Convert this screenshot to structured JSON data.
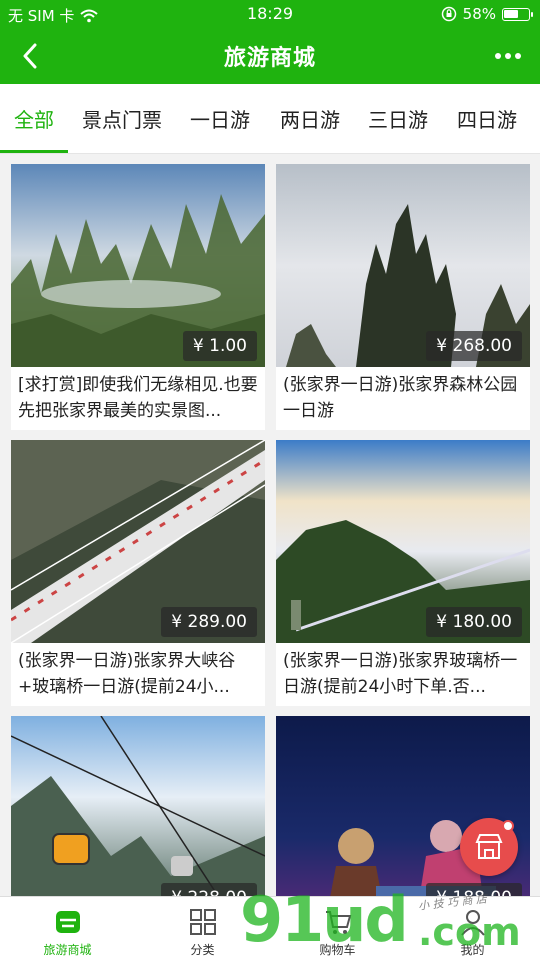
{
  "status": {
    "carrier": "无 SIM 卡",
    "time": "18:29",
    "battery_pct": "58%"
  },
  "navbar": {
    "title": "旅游商城"
  },
  "tabs": [
    {
      "label": "全部"
    },
    {
      "label": "景点门票"
    },
    {
      "label": "一日游"
    },
    {
      "label": "两日游"
    },
    {
      "label": "三日游"
    },
    {
      "label": "四日游"
    }
  ],
  "products": [
    {
      "price": "¥ 1.00",
      "title": "[求打赏]即使我们无缘相见.也要先把张家界最美的实景图..."
    },
    {
      "price": "¥ 268.00",
      "title": "(张家界一日游)张家界森林公园一日游"
    },
    {
      "price": "¥ 289.00",
      "title": "(张家界一日游)张家界大峡谷+玻璃桥一日游(提前24小..."
    },
    {
      "price": "¥ 180.00",
      "title": "(张家界一日游)张家界玻璃桥一日游(提前24小时下单.否..."
    },
    {
      "price": "¥ 228.00",
      "title": ""
    },
    {
      "price": "¥ 188.00",
      "title": ""
    }
  ],
  "bottom_nav": [
    {
      "label": "旅游商城",
      "icon": "store-icon"
    },
    {
      "label": "分类",
      "icon": "grid-icon"
    },
    {
      "label": "购物车",
      "icon": "cart-icon"
    },
    {
      "label": "我的",
      "icon": "user-icon"
    }
  ],
  "watermark": {
    "main": "91ud",
    "com": ".com",
    "sub": "小 技 巧 商 店"
  },
  "colors": {
    "brand": "#1fb30f",
    "fab": "#e74c4c"
  }
}
